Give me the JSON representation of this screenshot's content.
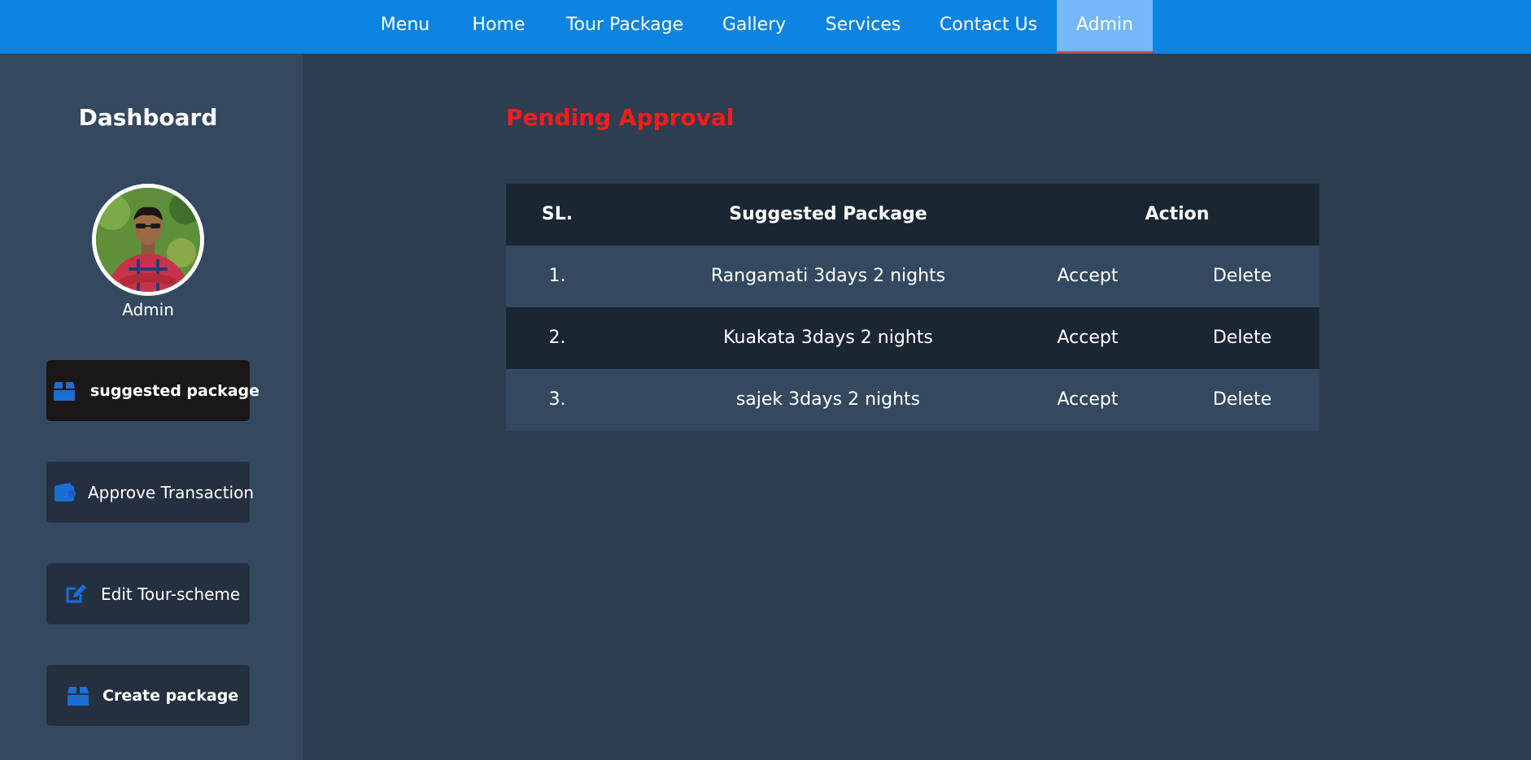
{
  "nav": {
    "items": [
      {
        "label": "Menu"
      },
      {
        "label": "Home"
      },
      {
        "label": "Tour Package"
      },
      {
        "label": "Gallery"
      },
      {
        "label": "Services"
      },
      {
        "label": "Contact Us"
      },
      {
        "label": "Admin",
        "active": true
      }
    ]
  },
  "sidebar": {
    "title": "Dashboard",
    "user_name": "Admin",
    "buttons": [
      {
        "label": "suggested package",
        "icon": "box-icon",
        "active": true
      },
      {
        "label": "Approve Transaction",
        "icon": "wallet-icon"
      },
      {
        "label": "Edit Tour-scheme",
        "icon": "edit-icon"
      },
      {
        "label": "Create package",
        "icon": "box-icon"
      }
    ]
  },
  "main": {
    "title": "Pending Approval",
    "table": {
      "headers": {
        "sl": "SL.",
        "package": "Suggested Package",
        "action": "Action"
      },
      "rows": [
        {
          "sl": "1.",
          "package": "Rangamati 3days 2 nights",
          "accept": "Accept",
          "delete": "Delete"
        },
        {
          "sl": "2.",
          "package": "Kuakata 3days 2 nights",
          "accept": "Accept",
          "delete": "Delete"
        },
        {
          "sl": "3.",
          "package": "sajek 3days 2 nights",
          "accept": "Accept",
          "delete": "Delete"
        }
      ]
    }
  },
  "colors": {
    "nav_bg": "#0a84e0",
    "nav_active_bg": "#74b8fa",
    "sidebar_bg": "#34495f",
    "main_bg": "#2e3e51",
    "title_red": "#ff1a1a",
    "icon_blue": "#1a6fd6"
  }
}
